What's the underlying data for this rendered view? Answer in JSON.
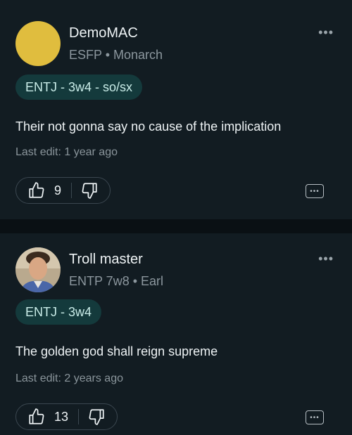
{
  "comments": [
    {
      "author": "DemoMAC",
      "type_line": "ESFP • Monarch",
      "avatar_color": "#e0bd3e",
      "tag": "ENTJ - 3w4 - so/sx",
      "text": "Their not gonna say no cause of the implication",
      "last_edit": "Last edit: 1 year ago",
      "upvotes": "9"
    },
    {
      "author": "Troll master",
      "type_line": "ENTP 7w8 • Earl",
      "tag": "ENTJ - 3w4",
      "text": "The golden god shall reign supreme",
      "last_edit": "Last edit: 2 years ago",
      "upvotes": "13"
    }
  ],
  "icons": {
    "more": "more-horizontal-icon",
    "upvote": "thumbs-up-icon",
    "downvote": "thumbs-down-icon",
    "menu": "ellipsis-box-icon"
  },
  "colors": {
    "background": "#121c22",
    "tag_bg": "#143a3c",
    "muted_text": "#8c979e"
  }
}
